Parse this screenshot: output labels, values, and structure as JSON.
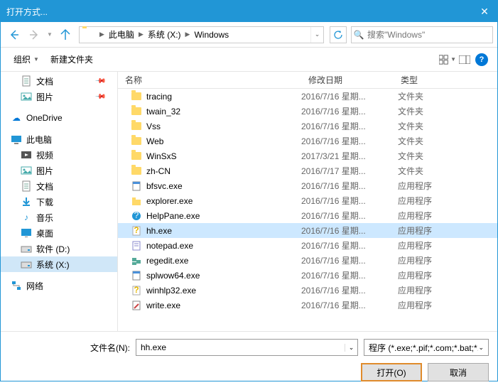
{
  "window": {
    "title": "打开方式..."
  },
  "breadcrumb": {
    "items": [
      "此电脑",
      "系统 (X:)",
      "Windows"
    ]
  },
  "search": {
    "placeholder": "搜索\"Windows\""
  },
  "toolbar": {
    "organize": "组织",
    "newfolder": "新建文件夹"
  },
  "sidebar": {
    "items": [
      {
        "label": "文档",
        "icon": "doc",
        "pinned": true
      },
      {
        "label": "图片",
        "icon": "pic",
        "pinned": true
      },
      {
        "label": "OneDrive",
        "icon": "onedrive",
        "top": true
      },
      {
        "label": "此电脑",
        "icon": "pc",
        "top": true
      },
      {
        "label": "视频",
        "icon": "video"
      },
      {
        "label": "图片",
        "icon": "pic"
      },
      {
        "label": "文档",
        "icon": "doc"
      },
      {
        "label": "下载",
        "icon": "download"
      },
      {
        "label": "音乐",
        "icon": "music"
      },
      {
        "label": "桌面",
        "icon": "desktop"
      },
      {
        "label": "软件 (D:)",
        "icon": "disk"
      },
      {
        "label": "系统 (X:)",
        "icon": "disk",
        "selected": true
      },
      {
        "label": "网络",
        "icon": "network",
        "top": true
      }
    ]
  },
  "columns": {
    "name": "名称",
    "date": "修改日期",
    "type": "类型"
  },
  "files": [
    {
      "name": "tracing",
      "date": "2016/7/16 星期...",
      "type": "文件夹",
      "kind": "folder"
    },
    {
      "name": "twain_32",
      "date": "2016/7/16 星期...",
      "type": "文件夹",
      "kind": "folder"
    },
    {
      "name": "Vss",
      "date": "2016/7/16 星期...",
      "type": "文件夹",
      "kind": "folder"
    },
    {
      "name": "Web",
      "date": "2016/7/16 星期...",
      "type": "文件夹",
      "kind": "folder"
    },
    {
      "name": "WinSxS",
      "date": "2017/3/21 星期...",
      "type": "文件夹",
      "kind": "folder"
    },
    {
      "name": "zh-CN",
      "date": "2016/7/17 星期...",
      "type": "文件夹",
      "kind": "folder"
    },
    {
      "name": "bfsvc.exe",
      "date": "2016/7/16 星期...",
      "type": "应用程序",
      "kind": "exe"
    },
    {
      "name": "explorer.exe",
      "date": "2016/7/16 星期...",
      "type": "应用程序",
      "kind": "explorer"
    },
    {
      "name": "HelpPane.exe",
      "date": "2016/7/16 星期...",
      "type": "应用程序",
      "kind": "help"
    },
    {
      "name": "hh.exe",
      "date": "2016/7/16 星期...",
      "type": "应用程序",
      "kind": "hh",
      "selected": true
    },
    {
      "name": "notepad.exe",
      "date": "2016/7/16 星期...",
      "type": "应用程序",
      "kind": "notepad"
    },
    {
      "name": "regedit.exe",
      "date": "2016/7/16 星期...",
      "type": "应用程序",
      "kind": "regedit"
    },
    {
      "name": "splwow64.exe",
      "date": "2016/7/16 星期...",
      "type": "应用程序",
      "kind": "exe"
    },
    {
      "name": "winhlp32.exe",
      "date": "2016/7/16 星期...",
      "type": "应用程序",
      "kind": "hh"
    },
    {
      "name": "write.exe",
      "date": "2016/7/16 星期...",
      "type": "应用程序",
      "kind": "write"
    }
  ],
  "footer": {
    "filename_label": "文件名(N):",
    "filename_value": "hh.exe",
    "filter": "程序 (*.exe;*.pif;*.com;*.bat;*.",
    "open": "打开(O)",
    "cancel": "取消"
  }
}
